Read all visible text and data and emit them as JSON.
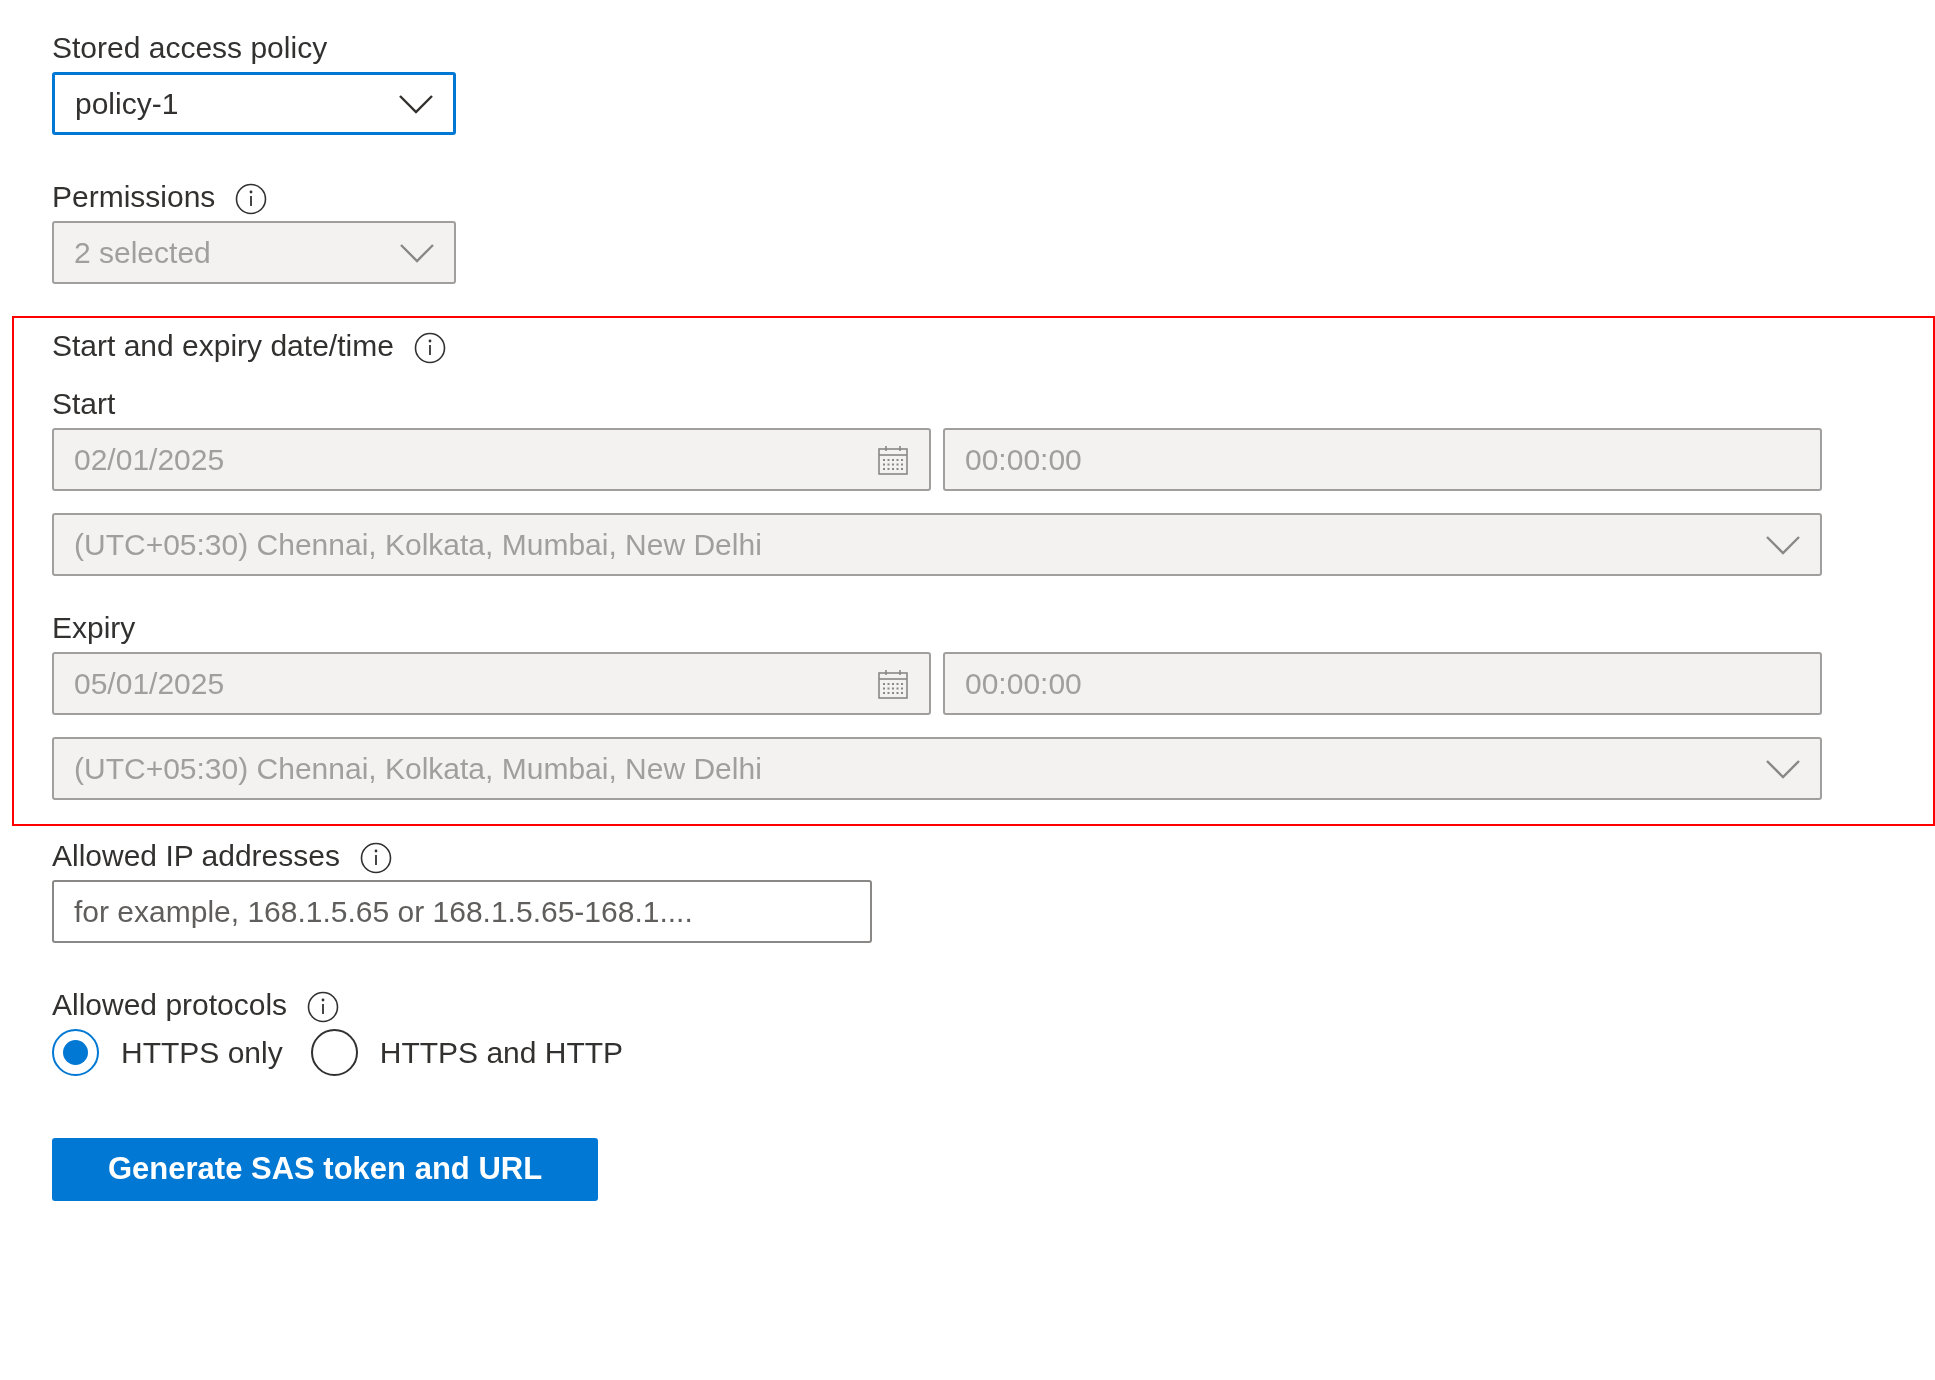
{
  "stored_access_policy": {
    "label": "Stored access policy",
    "value": "policy-1",
    "focused": true,
    "disabled": false
  },
  "permissions": {
    "label": "Permissions",
    "value": "2 selected",
    "focused": false,
    "disabled": true
  },
  "date_time": {
    "label": "Start and expiry date/time",
    "highlighted": true,
    "groups": [
      {
        "label": "Start",
        "date": "02/01/2025",
        "time": "00:00:00",
        "timezone": "(UTC+05:30) Chennai, Kolkata, Mumbai, New Delhi",
        "disabled": true
      },
      {
        "label": "Expiry",
        "date": "05/01/2025",
        "time": "00:00:00",
        "timezone": "(UTC+05:30) Chennai, Kolkata, Mumbai, New Delhi",
        "disabled": true
      }
    ]
  },
  "allowed_ip": {
    "label": "Allowed IP addresses",
    "placeholder": "for example, 168.1.5.65 or 168.1.5.65-168.1...."
  },
  "allowed_protocols": {
    "label": "Allowed protocols",
    "options": [
      {
        "label": "HTTPS only",
        "selected": true
      },
      {
        "label": "HTTPS and HTTP",
        "selected": false
      }
    ]
  },
  "button": "Generate SAS token and URL"
}
